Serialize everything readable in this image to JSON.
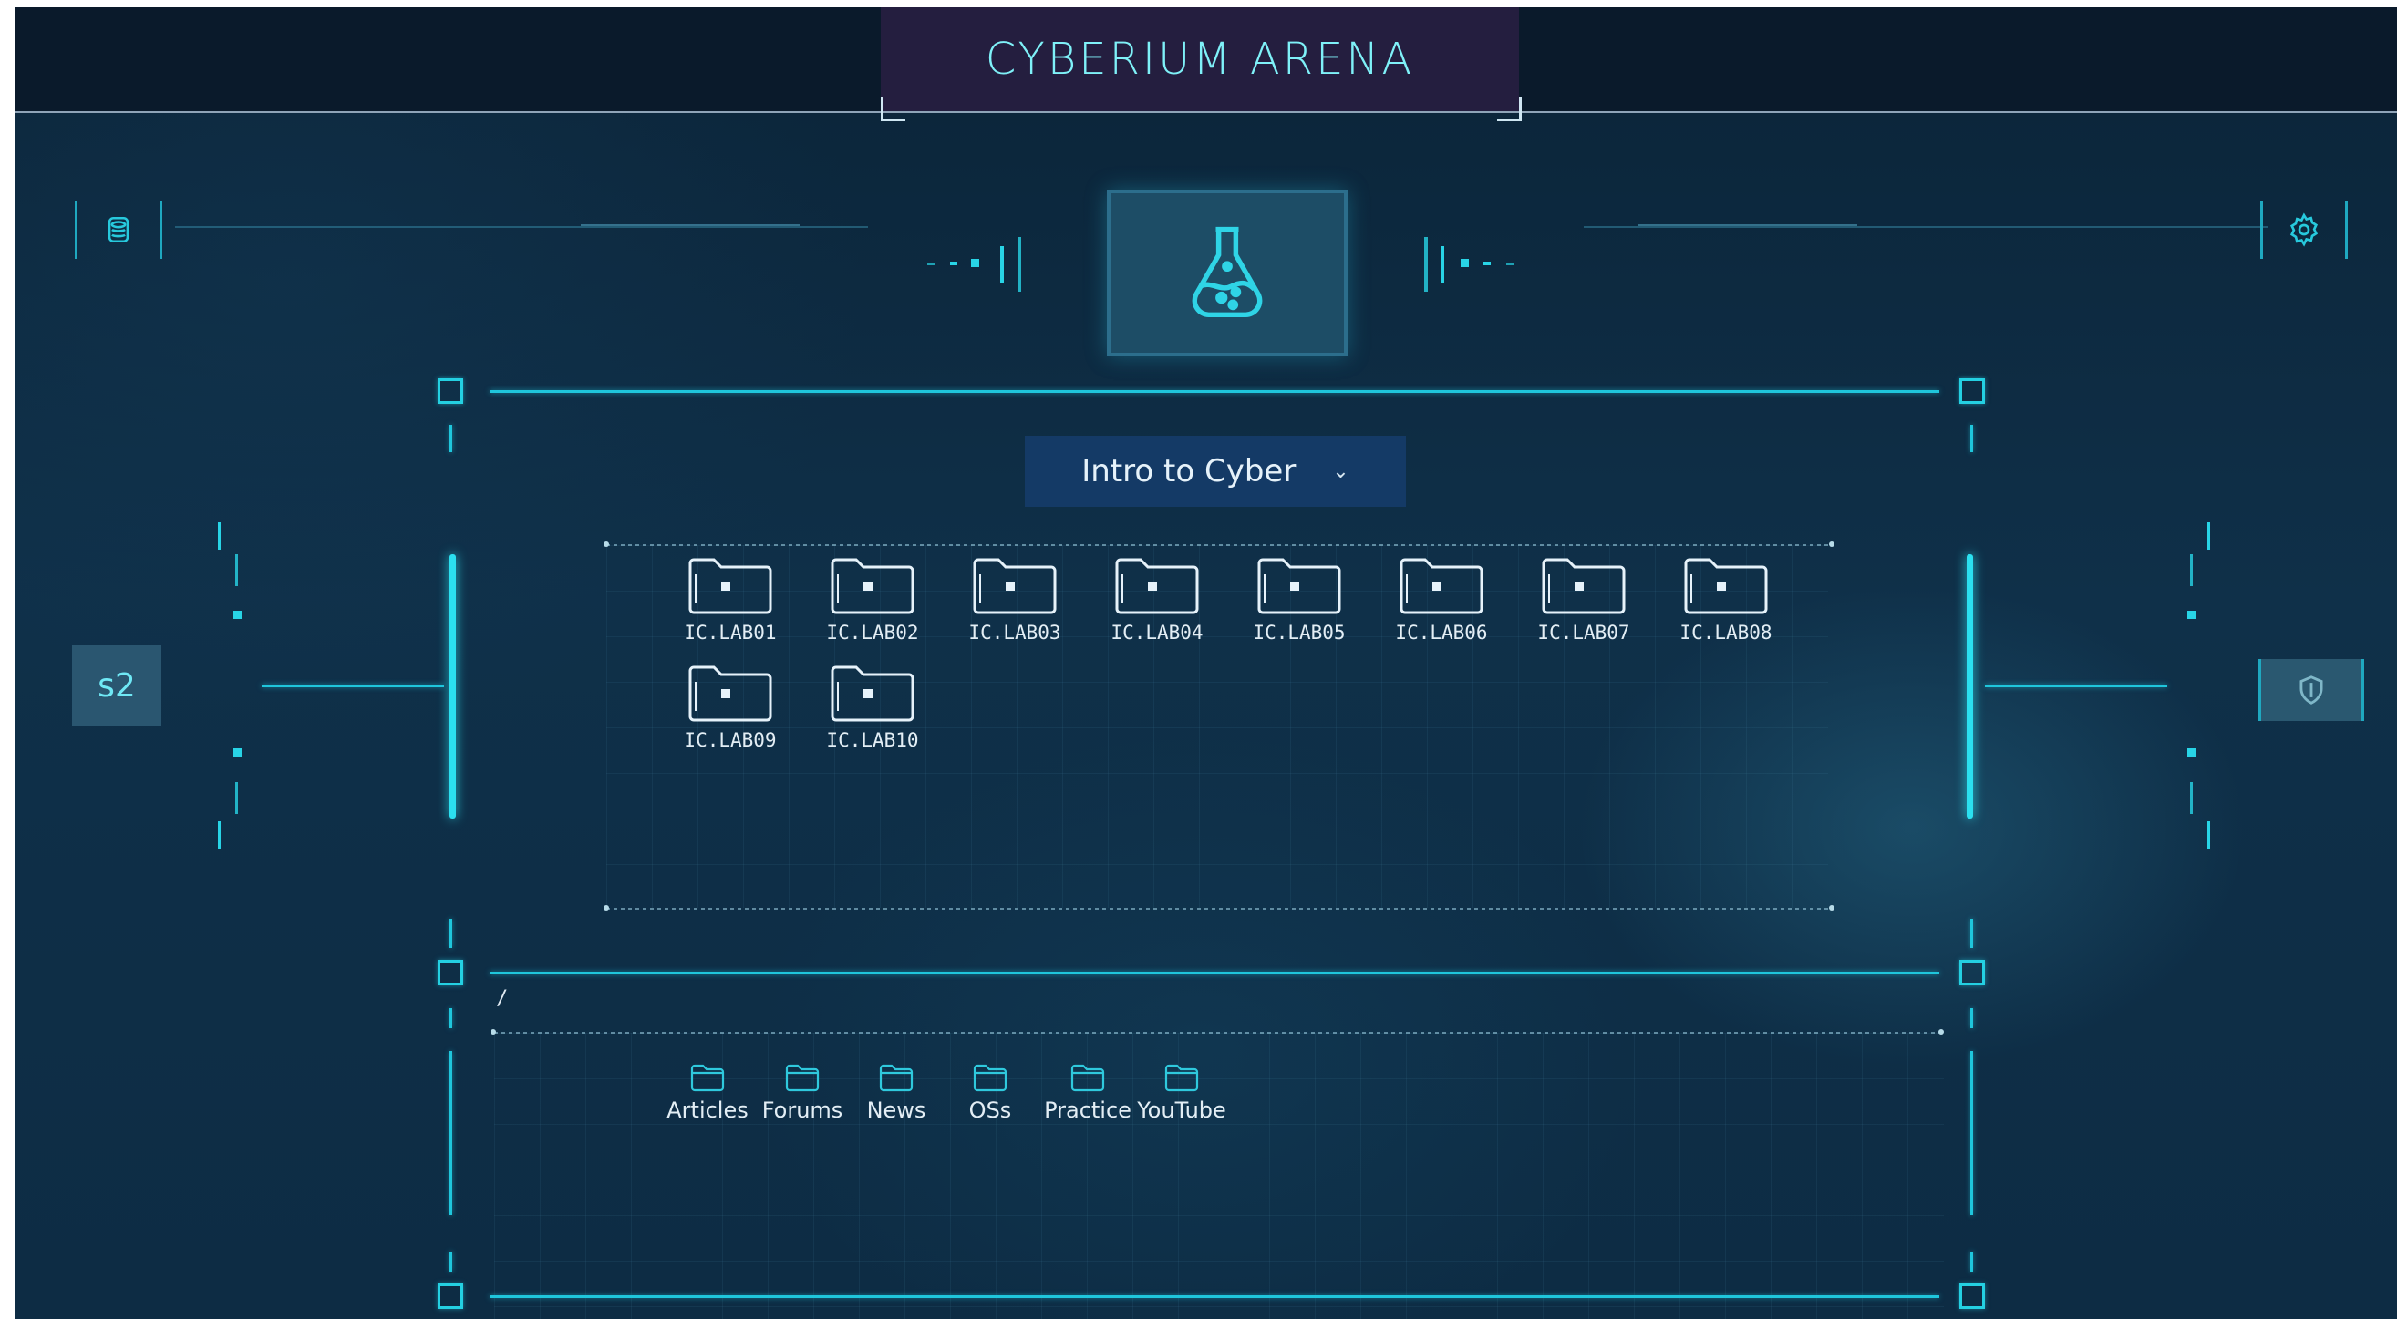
{
  "app": {
    "title": "CYBERIUM ARENA"
  },
  "course_selector": {
    "selected": "Intro to Cyber",
    "chevron": "⌄"
  },
  "labs": [
    {
      "label": "IC.LAB01"
    },
    {
      "label": "IC.LAB02"
    },
    {
      "label": "IC.LAB03"
    },
    {
      "label": "IC.LAB04"
    },
    {
      "label": "IC.LAB05"
    },
    {
      "label": "IC.LAB06"
    },
    {
      "label": "IC.LAB07"
    },
    {
      "label": "IC.LAB08"
    },
    {
      "label": "IC.LAB09"
    },
    {
      "label": "IC.LAB10"
    }
  ],
  "resources": {
    "path": "/",
    "items": [
      {
        "label": "Articles"
      },
      {
        "label": "Forums"
      },
      {
        "label": "News"
      },
      {
        "label": "OSs"
      },
      {
        "label": "Practice"
      },
      {
        "label": "YouTube"
      }
    ]
  },
  "left_panel": {
    "badge": "s2"
  },
  "icons": {
    "top_left": "database-icon",
    "top_right": "gear-icon",
    "center": "flask-icon",
    "right_panel": "shield-icon"
  },
  "colors": {
    "accent": "#1fc6dc",
    "title_text": "#7ff1f8",
    "title_bg": "#241e3f",
    "background": "#0f3049"
  }
}
